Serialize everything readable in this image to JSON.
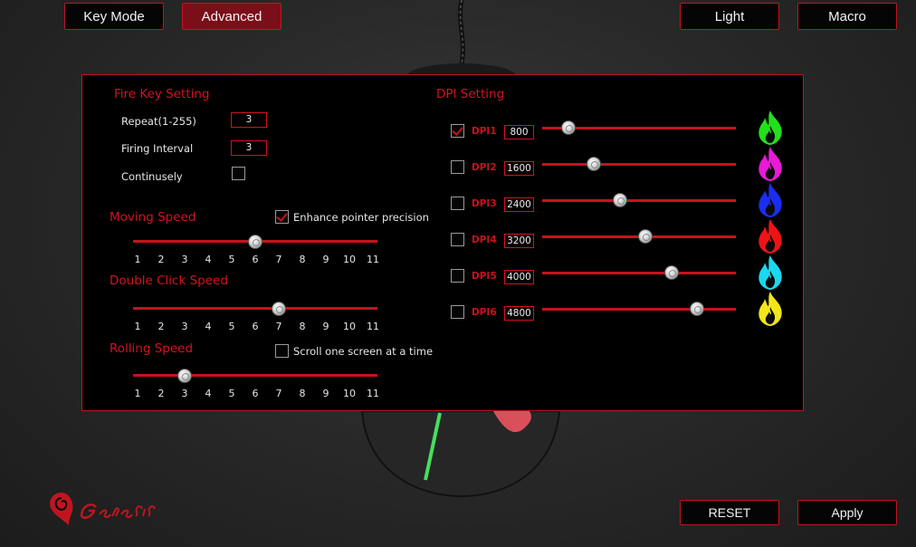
{
  "tabs": {
    "key_mode": "Key Mode",
    "advanced": "Advanced",
    "light": "Light",
    "macro": "Macro"
  },
  "fire_key": {
    "title": "Fire Key Setting",
    "repeat_label": "Repeat(1-255)",
    "repeat_value": "3",
    "interval_label": "Firing Interval",
    "interval_value": "3",
    "continuous_label": "Continusely",
    "continuous_checked": false
  },
  "moving_speed": {
    "title": "Moving Speed",
    "enhance_label": "Enhance pointer precision",
    "enhance_checked": true,
    "value": 6
  },
  "double_click": {
    "title": "Double Click Speed",
    "value": 7
  },
  "rolling": {
    "title": "Rolling Speed",
    "scroll_label": "Scroll one screen at a time",
    "scroll_checked": false,
    "value": 3
  },
  "scale_ticks": [
    "1",
    "2",
    "3",
    "4",
    "5",
    "6",
    "7",
    "8",
    "9",
    "10",
    "11"
  ],
  "dpi": {
    "title": "DPI Setting",
    "max": 6000,
    "levels": [
      {
        "label": "DPI1",
        "value": "800",
        "checked": true,
        "color": "#22e01a"
      },
      {
        "label": "DPI2",
        "value": "1600",
        "checked": false,
        "color": "#e91ad8"
      },
      {
        "label": "DPI3",
        "value": "2400",
        "checked": false,
        "color": "#1a2ef0"
      },
      {
        "label": "DPI4",
        "value": "3200",
        "checked": false,
        "color": "#ee1414"
      },
      {
        "label": "DPI5",
        "value": "4000",
        "checked": false,
        "color": "#1ad8ee"
      },
      {
        "label": "DPI6",
        "value": "4800",
        "checked": false,
        "color": "#f2e51a"
      }
    ]
  },
  "buttons": {
    "reset": "RESET",
    "apply": "Apply"
  },
  "brand": {
    "logo_text": "Genesis",
    "accent": "#c0151f"
  }
}
